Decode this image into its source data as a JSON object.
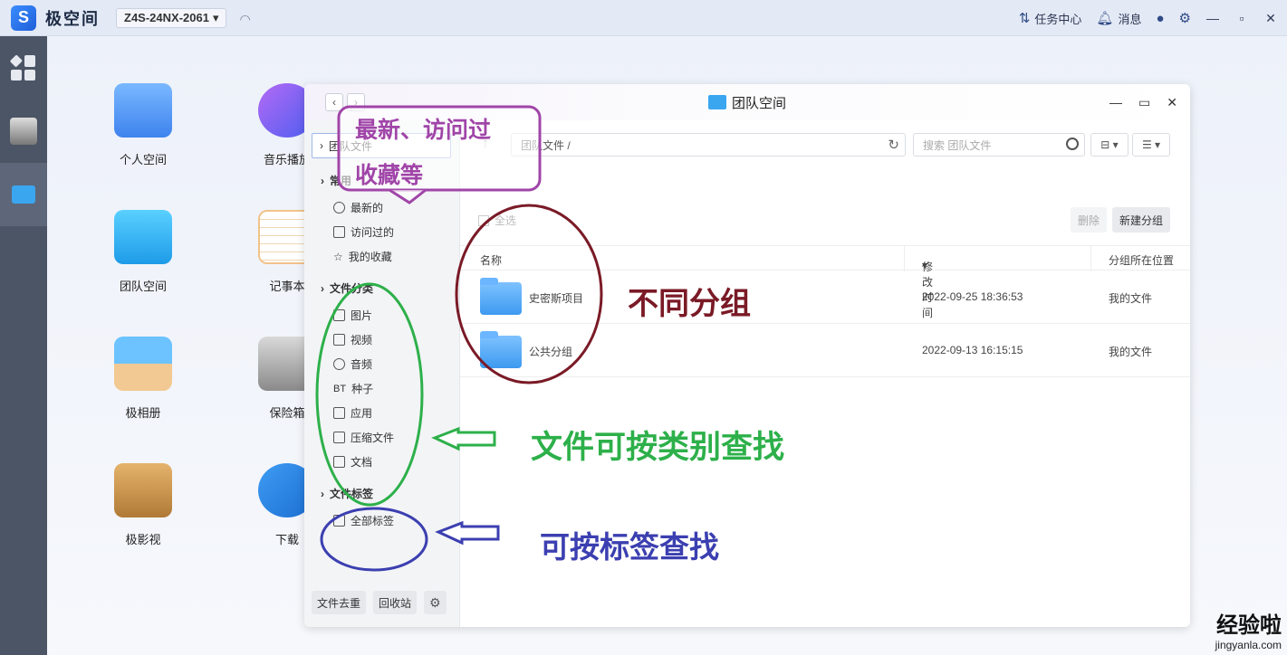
{
  "topbar": {
    "app_name": "极空间",
    "device": "Z4S-24NX-2061",
    "tasks": "任务中心",
    "messages": "消息",
    "colors": {
      "bg": "#e3e9f5",
      "accent": "#2f4a86"
    }
  },
  "desktop": {
    "icons": [
      {
        "label": "个人空间",
        "icon": "folder-icon"
      },
      {
        "label": "音乐播放",
        "icon": "music-icon"
      },
      {
        "label": "团队空间",
        "icon": "team-folder-icon"
      },
      {
        "label": "记事本",
        "icon": "notepad-icon"
      },
      {
        "label": "极相册",
        "icon": "photo-icon"
      },
      {
        "label": "保险箱",
        "icon": "safe-icon"
      },
      {
        "label": "极影视",
        "icon": "video-icon"
      },
      {
        "label": "下载",
        "icon": "download-icon"
      }
    ]
  },
  "window": {
    "title": "团队空间",
    "sidebar": {
      "selected": "团队文件",
      "common_section": "常用",
      "common_items": [
        "最新的",
        "访问过的",
        "我的收藏"
      ],
      "category_section": "文件分类",
      "category_items": [
        "图片",
        "视频",
        "音频",
        "种子",
        "应用",
        "压缩文件",
        "文档"
      ],
      "tag_section": "文件标签",
      "tag_items": [
        "全部标签"
      ],
      "footer": [
        "文件去重",
        "回收站"
      ]
    },
    "path": "团队文件 /",
    "search_placeholder": "搜索 团队文件",
    "select_all": "全选",
    "delete_label": "删除",
    "new_group_label": "新建分组",
    "columns": {
      "name": "名称",
      "modified": "修改时间",
      "location": "分组所在位置"
    },
    "rows": [
      {
        "name": "史密斯项目",
        "modified": "2022-09-25 18:36:53",
        "location": "我的文件"
      },
      {
        "name": "公共分组",
        "modified": "2022-09-13 16:15:15",
        "location": "我的文件"
      }
    ]
  },
  "annotations": {
    "bubble_line1": "最新、访问过",
    "bubble_line2": "收藏等",
    "groups": "不同分组",
    "categories": "文件可按类别查找",
    "tags": "可按标签查找",
    "colors": {
      "purple": "#a045a8",
      "maroon": "#7a1a26",
      "green": "#2db04a",
      "blue": "#3b3fb0"
    }
  },
  "watermark": {
    "line1": "经验啦",
    "line2": "jingyanla.com"
  }
}
